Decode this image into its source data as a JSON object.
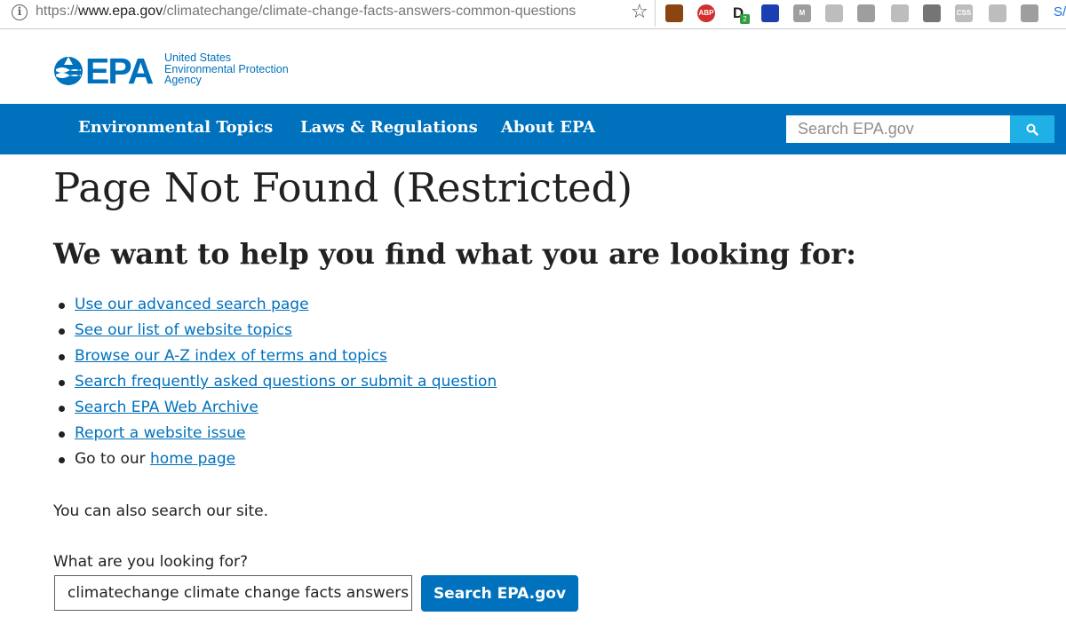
{
  "browser": {
    "url_scheme": "https://",
    "url_host": "www.epa.gov",
    "url_path": "/climatechange/climate-change-facts-answers-common-questions",
    "extensions": [
      {
        "name": "image-extension-icon",
        "color": "#8b4513",
        "label": ""
      },
      {
        "name": "adblock-plus-icon",
        "color": "#d32f2f",
        "label": "ABP"
      },
      {
        "name": "d-extension-icon",
        "color": "#222222",
        "label": "D"
      },
      {
        "name": "blue-column-extension-icon",
        "color": "#1a3fb0",
        "label": ""
      },
      {
        "name": "m-extension-icon",
        "color": "#9e9e9e",
        "label": "M"
      },
      {
        "name": "circle-extension-icon",
        "color": "#bdbdbd",
        "label": ""
      },
      {
        "name": "wrench-extension-icon",
        "color": "#9e9e9e",
        "label": ""
      },
      {
        "name": "tab-extension-icon",
        "color": "#bdbdbd",
        "label": ""
      },
      {
        "name": "shield-extension-icon",
        "color": "#757575",
        "label": ""
      },
      {
        "name": "css-extension-icon",
        "color": "#bdbdbd",
        "label": "CSS"
      },
      {
        "name": "slash-circle-extension-icon",
        "color": "#bdbdbd",
        "label": ""
      },
      {
        "name": "play-extension-icon",
        "color": "#9e9e9e",
        "label": ""
      }
    ],
    "d_badge": "2",
    "overflow_text": "S/"
  },
  "header": {
    "logo_text": "EPA",
    "agency_line1": "United States",
    "agency_line2": "Environmental Protection",
    "agency_line3": "Agency"
  },
  "nav": {
    "items": [
      "Environmental Topics",
      "Laws & Regulations",
      "About EPA"
    ],
    "search_placeholder": "Search EPA.gov"
  },
  "main": {
    "title": "Page Not Found (Restricted)",
    "subtitle": "We want to help you find what you are looking for:",
    "links": [
      "Use our advanced search page",
      "See our list of website topics",
      "Browse our A-Z index of terms and topics",
      "Search frequently asked questions or submit a question",
      "Search EPA Web Archive",
      "Report a website issue"
    ],
    "home_prefix": "Go to our ",
    "home_link": "home page",
    "also_search": "You can also search our site.",
    "search_label": "What are you looking for?",
    "search_value": "climatechange climate change facts answers common questions",
    "search_button": "Search EPA.gov"
  },
  "colors": {
    "epa_blue": "#0071bc",
    "search_button_cyan": "#1fb1e6",
    "text": "#212121"
  }
}
